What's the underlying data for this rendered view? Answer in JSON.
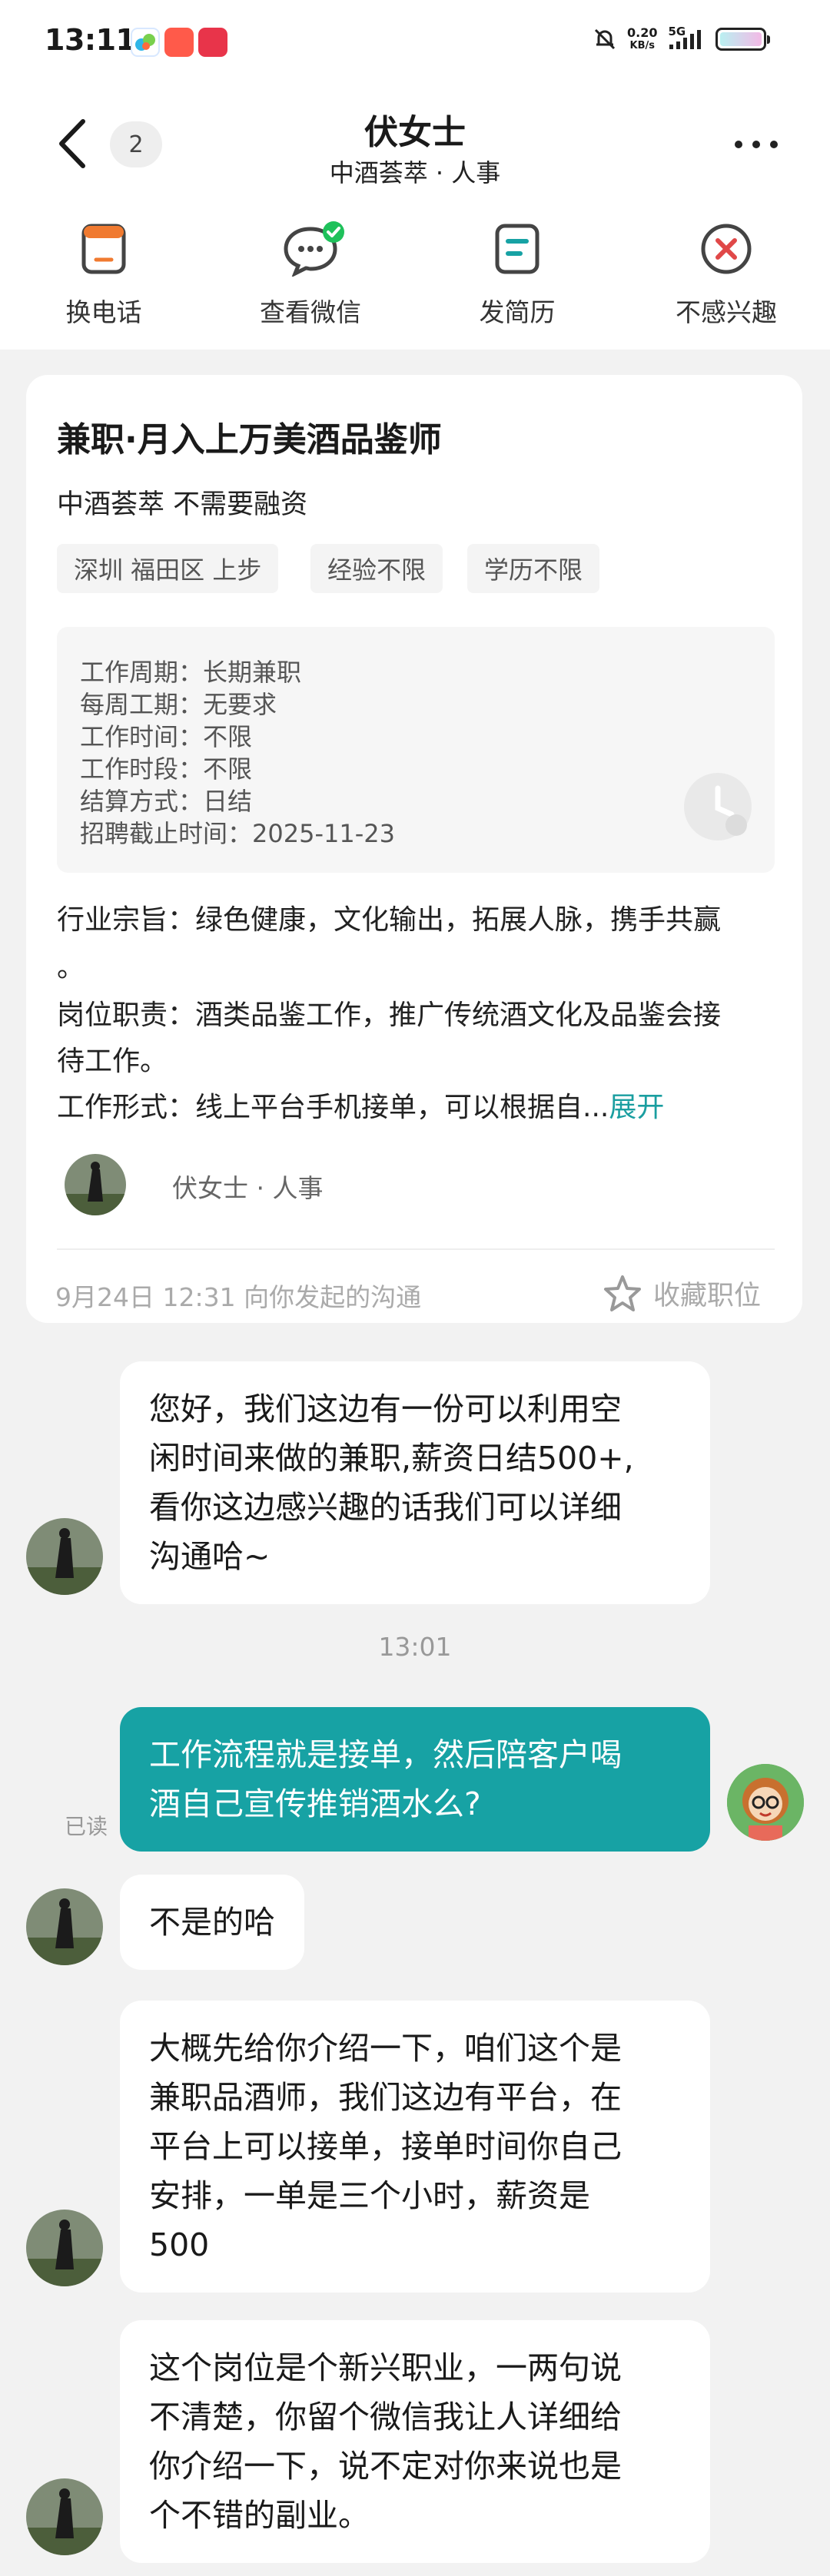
{
  "status_bar": {
    "time": "13:11",
    "net_speed_value": "0.20",
    "net_speed_unit": "KB/s",
    "signal_label": "5G"
  },
  "nav": {
    "unread_count": "2",
    "title": "伏女士",
    "subtitle": "中酒荟萃 · 人事"
  },
  "actions": [
    {
      "label": "换电话",
      "icon": "phone-swap-icon"
    },
    {
      "label": "查看微信",
      "icon": "wechat-icon"
    },
    {
      "label": "发简历",
      "icon": "resume-icon"
    },
    {
      "label": "不感兴趣",
      "icon": "close-circle-icon"
    }
  ],
  "job": {
    "title": "兼职·月入上万美酒品鉴师",
    "company": "中酒荟萃  不需要融资",
    "tags": [
      "深圳 福田区 上步",
      "经验不限",
      "学历不限"
    ],
    "info": [
      "工作周期：长期兼职",
      "每周工期：无要求",
      "工作时间：不限",
      "工作时段：不限",
      "结算方式：日结",
      "招聘截止时间：2025-11-23"
    ],
    "description": [
      "行业宗旨：绿色健康，文化输出，拓展人脉，携手共赢",
      "。",
      "岗位职责：酒类品鉴工作，推广传统酒文化及品鉴会接",
      "待工作。"
    ],
    "description_last": "工作形式：线上平台手机接单，可以根据自...",
    "expand_label": "展开",
    "hr_name": "伏女士 · 人事",
    "footer_time": "9月24日 12:31 向你发起的沟通",
    "favorite_label": "收藏职位"
  },
  "chat": {
    "msg1": [
      "您好，我们这边有一份可以利用空",
      "闲时间来做的兼职,薪资日结500+,",
      "看你这边感兴趣的话我们可以详细",
      "沟通哈~"
    ],
    "time_separator": "13:01",
    "msg2": [
      "工作流程就是接单，然后陪客户喝",
      "酒自己宣传推销酒水么?"
    ],
    "read_label": "已读",
    "msg3": [
      "不是的哈"
    ],
    "msg4": [
      "大概先给你介绍一下，咱们这个是",
      "兼职品酒师，我们这边有平台，在",
      "平台上可以接单，接单时间你自己",
      "安排，一单是三个小时，薪资是",
      "500"
    ],
    "msg5": [
      "这个岗位是个新兴职业，一两句说",
      "不清楚，你留个微信我让人详细给",
      "你介绍一下，说不定对你来说也是",
      "个不错的副业。"
    ]
  },
  "colors": {
    "accent": "#17a2a4",
    "page_bg": "#f2f2f2",
    "check_green": "#1fc15b",
    "reject_red": "#e04848"
  }
}
